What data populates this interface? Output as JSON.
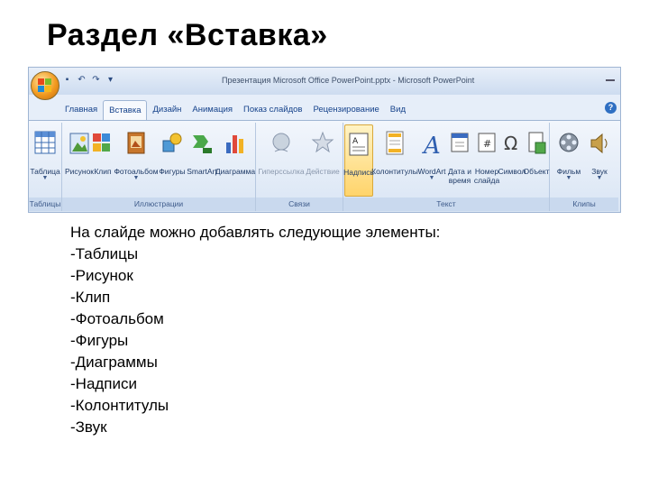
{
  "slide": {
    "title": "Раздел «Вставка»",
    "intro": "На слайде можно добавлять следующие элементы:",
    "items": [
      "-Таблицы",
      "-Рисунок",
      "-Клип",
      "-Фотоальбом",
      "-Фигуры",
      "-Диаграммы",
      "-Надписи",
      "-Колонтитулы",
      "-Звук"
    ]
  },
  "window": {
    "title": "Презентация Microsoft Office PowerPoint.pptx - Microsoft PowerPoint",
    "help_glyph": "?"
  },
  "tabs": [
    "Главная",
    "Вставка",
    "Дизайн",
    "Анимация",
    "Показ слайдов",
    "Рецензирование",
    "Вид"
  ],
  "active_tab": "Вставка",
  "groups": {
    "tables": {
      "label": "Таблицы",
      "buttons": [
        "Таблица"
      ]
    },
    "illustrations": {
      "label": "Иллюстрации",
      "buttons": [
        "Рисунок",
        "Клип",
        "Фотоальбом",
        "Фигуры",
        "SmartArt",
        "Диаграмма"
      ]
    },
    "links": {
      "label": "Связи",
      "buttons": [
        "Гиперссылка",
        "Действие"
      ]
    },
    "text": {
      "label": "Текст",
      "buttons": [
        "Надпись",
        "Колонтитулы",
        "WordArt",
        "Дата и время",
        "Номер слайда",
        "Символ",
        "Объект"
      ]
    },
    "media": {
      "label": "Клипы мультимедиа",
      "buttons": [
        "Фильм",
        "Звук"
      ]
    }
  },
  "colors": {
    "ribbon_bg": "#e6eef9",
    "tab_text": "#15428b",
    "highlight": "#ffd46b"
  }
}
